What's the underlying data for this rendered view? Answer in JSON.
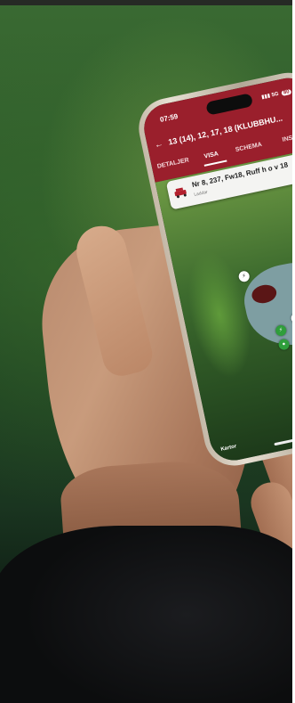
{
  "phone": {
    "status_time": "07:59",
    "status_signal": "5G",
    "status_battery": "80",
    "title": "13 (14), 12, 17, 18 (KLUBBHU...",
    "tabs": [
      {
        "label": "DETALJER",
        "active": false
      },
      {
        "label": "VISA",
        "active": true
      },
      {
        "label": "SCHEMA",
        "active": false
      },
      {
        "label": "INSTÄLL",
        "active": false
      }
    ],
    "card": {
      "title": "Nr 8, 237, Fw18, Ruff h o v 18",
      "subtitle": "Laddar"
    },
    "maps_label": "Kartor"
  },
  "colors": {
    "appbar": "#9a1f2c",
    "map_green": "#3d6b2e",
    "water": "#7e9ea2"
  },
  "icons": [
    "back-arrow-icon",
    "more-vertical-icon",
    "golf-cart-icon",
    "chevron-down-icon",
    "map-pin-icon",
    "apple-logo-icon"
  ]
}
